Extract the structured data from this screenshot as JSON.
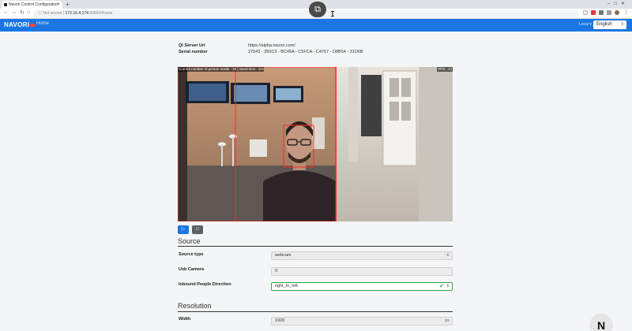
{
  "browser": {
    "tab_title": "Navori Control Configuration",
    "not_secure": "Not secure",
    "host": "172.16.4.174",
    "path": ":8085/#/home",
    "new_tab": "+",
    "close_tab": "×"
  },
  "navbar": {
    "brand": "NAVORI",
    "home": "Home",
    "user": "Local ▾",
    "language": "English"
  },
  "info": {
    "server_label": "QI Server Url",
    "server_value": "https://alpha.navori.com/",
    "serial_label": "Serial number",
    "serial_value": "27543 - 350C3 - BC45A - C5FCA - C4767 - D8B54 - 31D6B"
  },
  "video": {
    "overlay_left": "Current number of person inside : 29 | Seed time : 1%",
    "overlay_right": "FPS : 14"
  },
  "controls": {
    "play_icon": "▷",
    "stop_icon": "□"
  },
  "source": {
    "title": "Source",
    "fields": [
      {
        "label": "Source type",
        "value": "webcam"
      },
      {
        "label": "Usb Camera",
        "value": "0"
      },
      {
        "label": "Inbound People Direction",
        "value": "right_to_left"
      }
    ]
  },
  "resolution": {
    "title": "Resolution",
    "width_label": "Width",
    "width_value": "1920",
    "width_unit": "px"
  },
  "watermark": "N",
  "colors": {
    "navbar": "#1976e2",
    "play_button": "#1976e2",
    "stop_button": "#5a6268",
    "valid_border": "#38a34a"
  }
}
